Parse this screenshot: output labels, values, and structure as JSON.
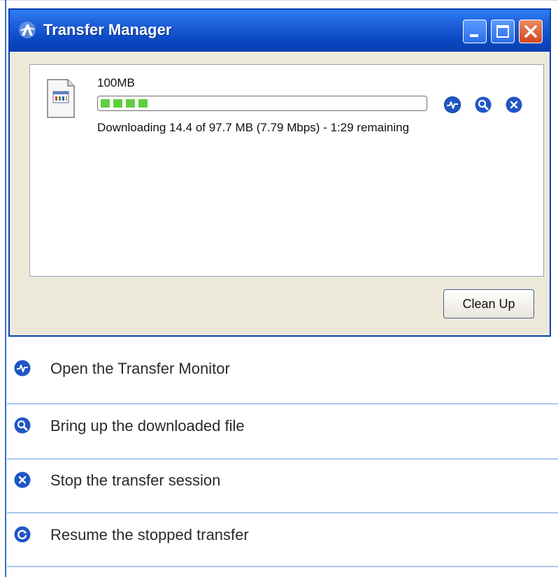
{
  "window": {
    "title": "Transfer Manager",
    "controls": [
      "minimize-icon",
      "maximize-icon",
      "close-icon"
    ]
  },
  "transfer": {
    "file_name": "100MB",
    "progress_fraction": 0.147,
    "status": "Downloading 14.4 of 97.7 MB (7.79 Mbps) - 1:29 remaining",
    "actions": [
      "transfer-monitor-icon",
      "open-file-icon",
      "stop-icon"
    ]
  },
  "buttons": {
    "clean_up": "Clean Up"
  },
  "legend": [
    {
      "icon": "transfer-monitor-icon",
      "text": "Open the Transfer Monitor"
    },
    {
      "icon": "open-file-icon",
      "text": "Bring up the downloaded file"
    },
    {
      "icon": "stop-icon",
      "text": "Stop the transfer session"
    },
    {
      "icon": "resume-icon",
      "text": "Resume the stopped transfer"
    }
  ],
  "colors": {
    "titlebar": "#0b49c5",
    "progress": "#5fce3f",
    "icon_blue": "#1e56c6",
    "separator": "#a9c9ee"
  }
}
